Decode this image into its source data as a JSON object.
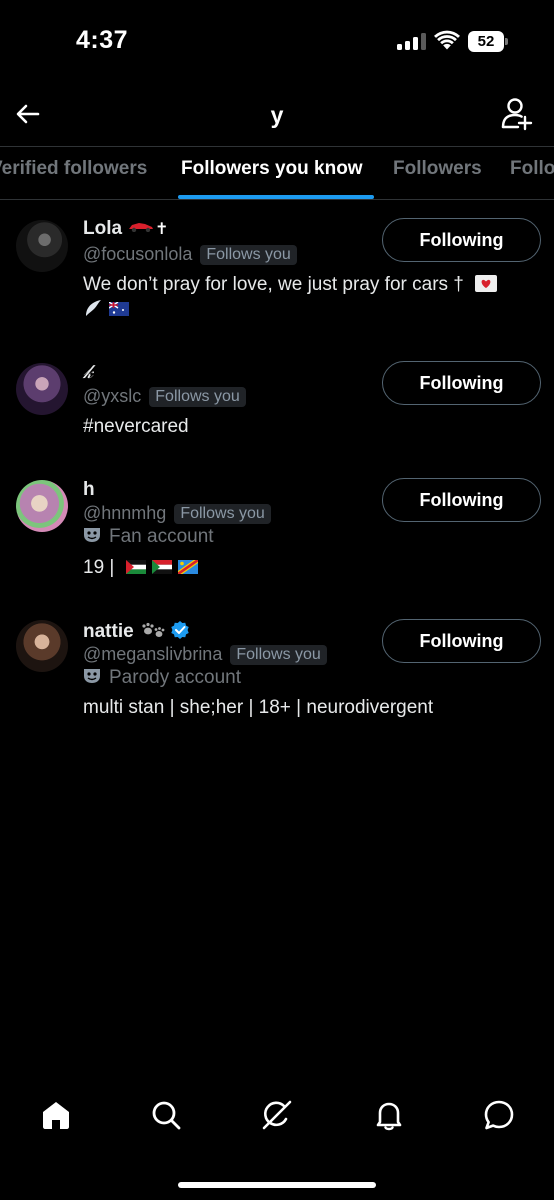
{
  "status_bar": {
    "time": "4:37",
    "battery": "52"
  },
  "header": {
    "title": "y"
  },
  "tabs": [
    {
      "label": "Verified followers"
    },
    {
      "label": "Followers you know"
    },
    {
      "label": "Followers"
    },
    {
      "label": "Following"
    }
  ],
  "badge_label": "Follows you",
  "users": [
    {
      "name": "Lola",
      "handle": "@focusonlola",
      "follows_you": true,
      "bio_line1": "We don’t pray for love, we just pray for cars †",
      "bio_line2": "",
      "button": "Following"
    },
    {
      "name": "𝓀",
      "handle": "@yxslc",
      "follows_you": true,
      "bio_line1": "#nevercared",
      "button": "Following"
    },
    {
      "name": "h",
      "handle": "@hnnmhg",
      "follows_you": true,
      "account_label": "Fan account",
      "bio_line1": "19 |",
      "button": "Following"
    },
    {
      "name": "nattie",
      "handle": "@meganslivbrina",
      "follows_you": true,
      "verified": true,
      "account_label": "Parody account",
      "bio_line1": "multi stan | she;her | 18+ | neurodivergent",
      "button": "Following"
    }
  ],
  "colors": {
    "accent": "#1d9bf0",
    "background": "#000000",
    "muted": "#71767b"
  }
}
